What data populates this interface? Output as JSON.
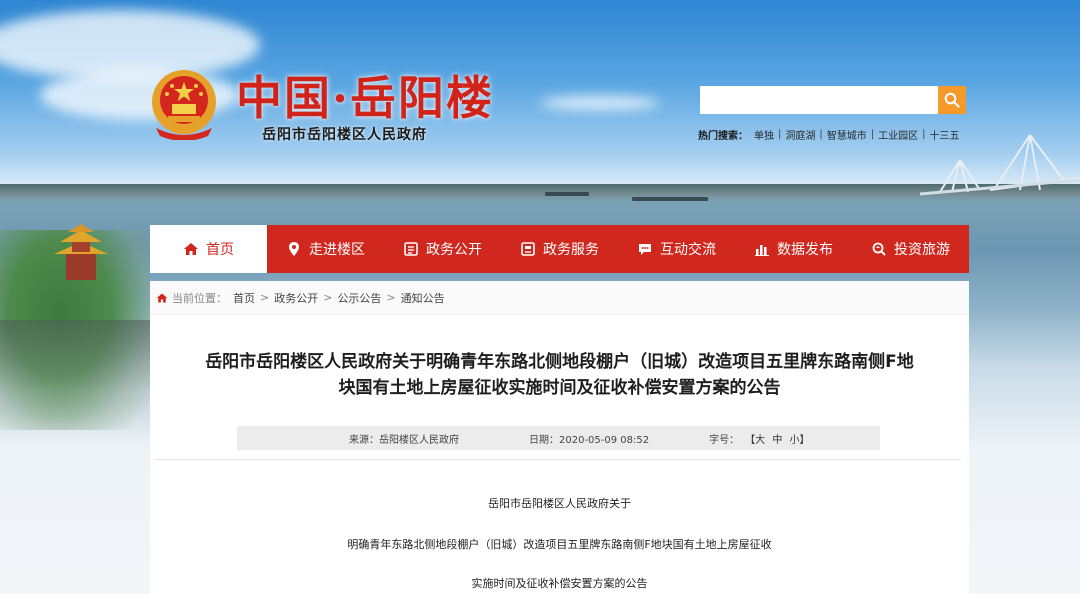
{
  "header": {
    "site_title": "中国·岳阳楼",
    "site_subtitle": "岳阳市岳阳楼区人民政府",
    "search_placeholder": "",
    "hot_label": "热门搜索：",
    "hot_links": [
      "单独",
      "洞庭湖",
      "智慧城市",
      "工业园区",
      "十三五"
    ]
  },
  "nav": {
    "items": [
      {
        "label": "首页",
        "icon": "home-icon",
        "active": true
      },
      {
        "label": "走进楼区",
        "icon": "map-pin-icon"
      },
      {
        "label": "政务公开",
        "icon": "document-icon"
      },
      {
        "label": "政务服务",
        "icon": "service-icon"
      },
      {
        "label": "互动交流",
        "icon": "chat-icon"
      },
      {
        "label": "数据发布",
        "icon": "bar-chart-icon"
      },
      {
        "label": "投资旅游",
        "icon": "search-tour-icon"
      }
    ]
  },
  "breadcrumb": {
    "label": "当前位置：",
    "items": [
      "首页",
      "政务公开",
      "公示公告",
      "通知公告"
    ]
  },
  "article": {
    "title_line1": "岳阳市岳阳楼区人民政府关于明确青年东路北侧地段棚户（旧城）改造项目五里牌东路南侧F地",
    "title_line2": "块国有土地上房屋征收实施时间及征收补偿安置方案的公告",
    "meta": {
      "source": "来源：岳阳楼区人民政府",
      "date": "日期：2020-05-09 08:52",
      "font_label": "字号：",
      "font_sizes": [
        "【大",
        "中",
        "小】"
      ]
    },
    "body_lines": [
      "岳阳市岳阳楼区人民政府关于",
      "明确青年东路北侧地段棚户（旧城）改造项目五里牌东路南侧F地块国有土地上房屋征收",
      "实施时间及征收补偿安置方案的公告"
    ]
  },
  "colors": {
    "nav_red": "#d0281f",
    "title_red": "#d2231b",
    "search_orange": "#f39a2b"
  }
}
